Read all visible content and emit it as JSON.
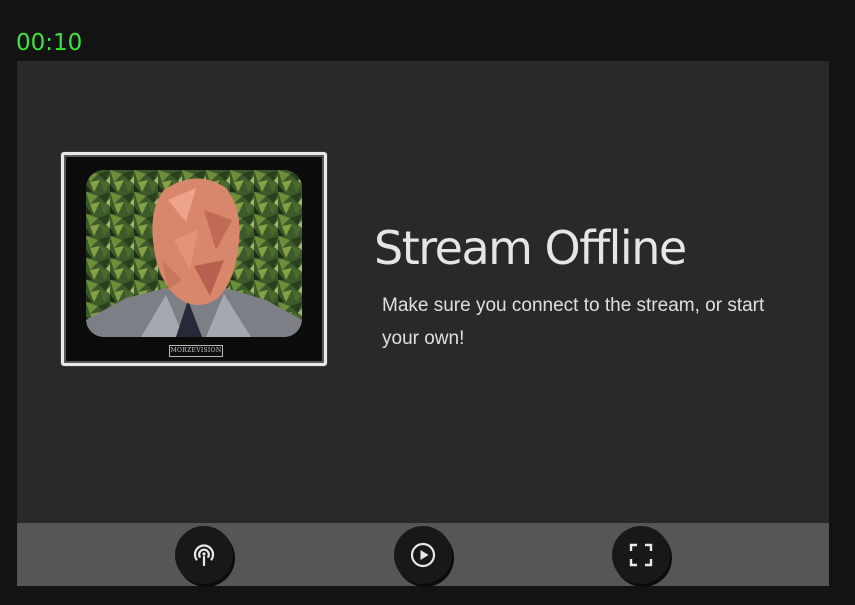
{
  "timer": {
    "text": "00:10"
  },
  "stream": {
    "title": "Stream Offline",
    "message": "Make sure you connect to the stream, or start your own!",
    "tv_brand": "MORZEVISION"
  },
  "controls": {
    "buttons": [
      {
        "icon": "broadcast-icon"
      },
      {
        "icon": "play-icon"
      },
      {
        "icon": "fullscreen-icon"
      }
    ]
  },
  "colors": {
    "timer": "#39e639",
    "player_bg": "#2a2829",
    "controls_bg": "#585654",
    "button_bg": "#181818",
    "page_bg": "#131313"
  }
}
